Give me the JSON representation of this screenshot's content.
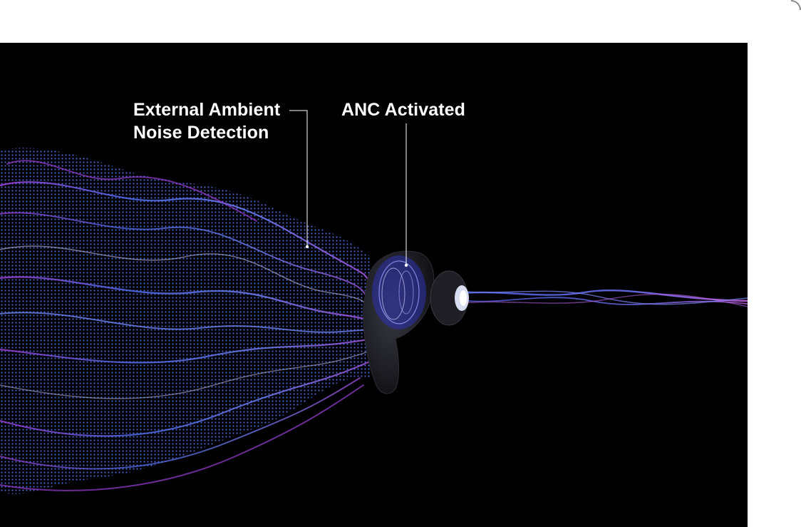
{
  "labels": {
    "external_line1": "External Ambient",
    "external_line2": "Noise Detection",
    "anc": "ANC Activated"
  },
  "colors": {
    "background": "#000000",
    "wave_blue": "#4f6be8",
    "wave_purple": "#a040d8",
    "wave_highlight": "#c8c8ff",
    "earbud": "#1a1a1f"
  },
  "icons": {
    "earbud": "anc-earbud-icon"
  }
}
